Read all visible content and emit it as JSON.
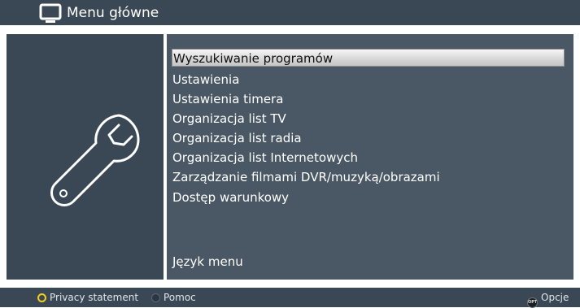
{
  "header": {
    "title": "Menu główne",
    "icon": "tv-icon"
  },
  "sidebar": {
    "icon": "wrench-icon"
  },
  "menu": {
    "items": [
      {
        "label": "Wyszukiwanie programów",
        "selected": true
      },
      {
        "label": "Ustawienia"
      },
      {
        "label": "Ustawienia timera"
      },
      {
        "label": "Organizacja list TV"
      },
      {
        "label": "Organizacja list radia"
      },
      {
        "label": "Organizacja list Internetowych"
      },
      {
        "label": "Zarządzanie filmami DVR/muzyką/obrazami"
      },
      {
        "label": "Dostęp warunkowy"
      },
      {
        "label": "Język menu"
      }
    ]
  },
  "footer": {
    "privacy": "Privacy statement",
    "help": "Pomoc",
    "opt_badge": "OPT",
    "options": "Opcje"
  },
  "colors": {
    "panel": "#3a4855",
    "panel_right": "#4a5764",
    "yellow_key": "#f2cf1a"
  }
}
